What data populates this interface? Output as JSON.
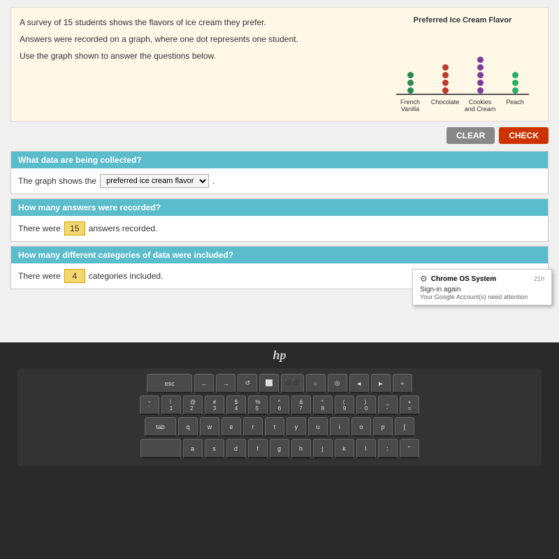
{
  "screen": {
    "problem": {
      "line1": "A survey of 15 students shows the flavors of ice cream they prefer.",
      "line2": "Answers were recorded on a graph, where one dot represents one student.",
      "line3": "Use the graph shown to answer the questions below."
    },
    "chart": {
      "title": "Preferred Ice Cream Flavor",
      "categories": [
        {
          "label": "French\nVanilla",
          "color": "#2a8a4a",
          "dots": 3
        },
        {
          "label": "Chocolate",
          "color": "#c0392b",
          "dots": 4
        },
        {
          "label": "Cookies\nand Cream",
          "color": "#7d3c98",
          "dots": 5
        },
        {
          "label": "Peach",
          "color": "#27ae60",
          "dots": 3
        }
      ]
    },
    "buttons": {
      "clear": "CLEAR",
      "check": "CHECK"
    },
    "questions": [
      {
        "header": "What data are being collected?",
        "body_prefix": "The graph shows the",
        "answer": "preferred ice cream flavor",
        "body_suffix": "."
      },
      {
        "header": "How many answers were recorded?",
        "body_prefix": "There were",
        "answer": "15",
        "body_suffix": "answers recorded."
      },
      {
        "header": "How many different categories of data were included?",
        "body_prefix": "There were",
        "answer": "4",
        "body_suffix": "categories included."
      }
    ]
  },
  "notification": {
    "icon": "⚙",
    "title": "Chrome OS System",
    "time": "· 21h",
    "line1": "Sign-in again",
    "line2": "Your Google Account(s) need attention"
  },
  "keyboard": {
    "rows": [
      [
        "esc",
        "←",
        "→",
        "↺",
        "⬜",
        "⬛⬛",
        "○",
        "◎",
        "◄",
        "►",
        "+"
      ],
      [
        "~\n`",
        "!\n1",
        "@\n2",
        "#\n3",
        "$\n4",
        "%\n5",
        "^\n6",
        "&\n7",
        "*\n8",
        "(\n9",
        ")\n0",
        "_\n-",
        "+\n="
      ],
      [
        "tab",
        "q",
        "w",
        "e",
        "r",
        "t",
        "y",
        "u",
        "i",
        "o",
        "p",
        "{"
      ],
      [
        "",
        "a",
        "s",
        "d",
        "f",
        "g",
        "h",
        "j",
        "k",
        "l",
        ":",
        "\""
      ]
    ]
  },
  "hp_logo": "hp"
}
